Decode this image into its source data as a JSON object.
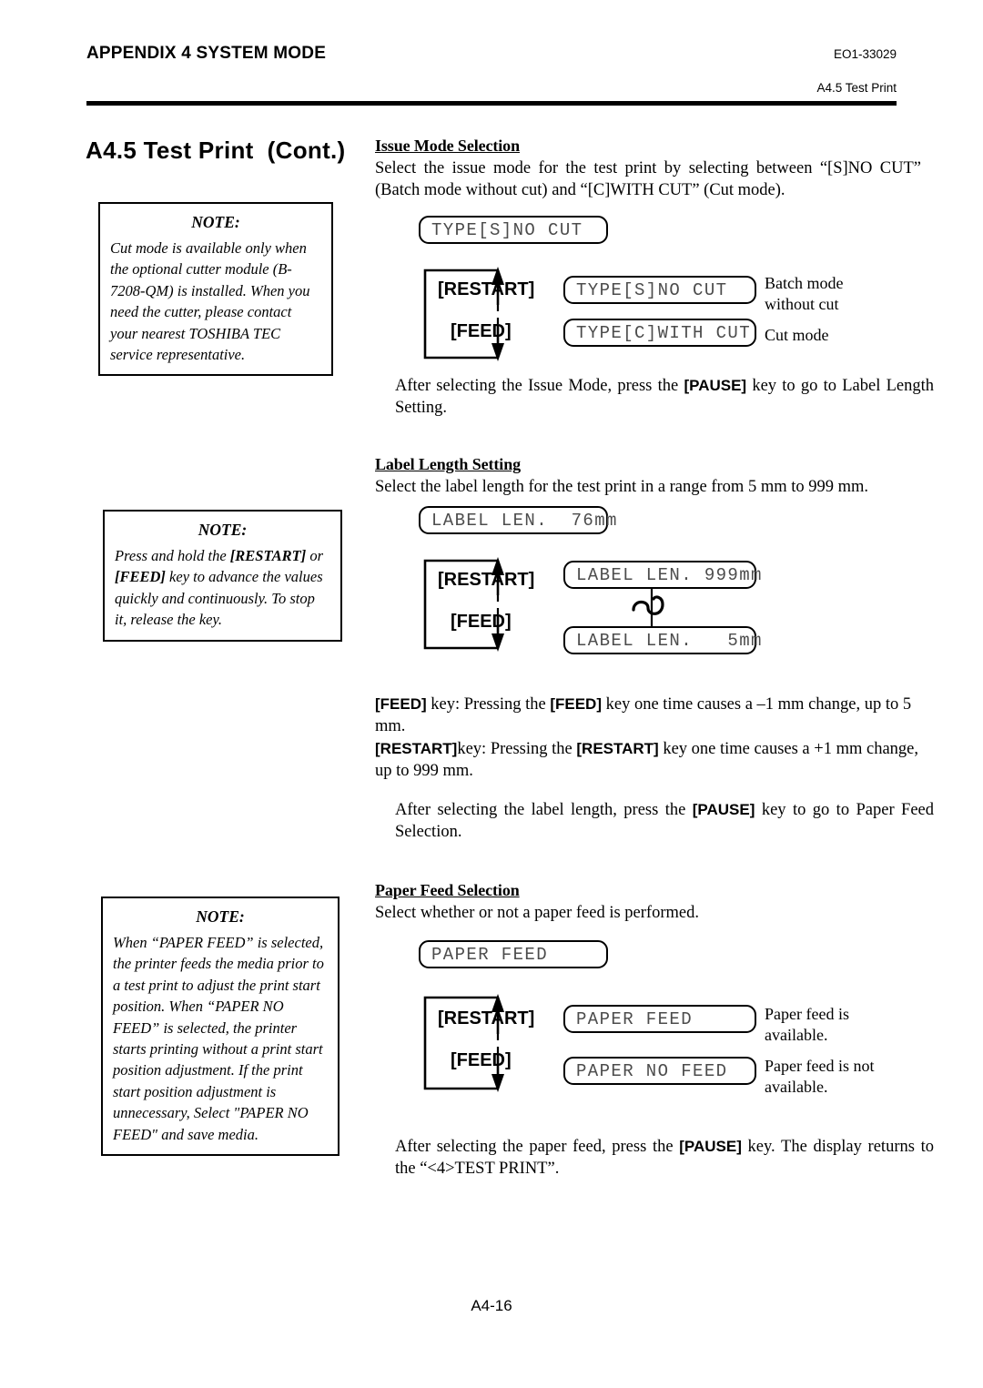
{
  "header": {
    "left_title": "APPENDIX 4 SYSTEM MODE",
    "doc_code": "EO1-33029",
    "section_ref": "A4.5 Test Print"
  },
  "page_title": "A4.5 Test Print  (Cont.)",
  "notes": [
    {
      "title": "NOTE:",
      "body": "Cut mode is available only when the optional cutter module (B-7208-QM) is installed.  When you need the cutter, please contact your nearest TOSHIBA TEC service representative."
    },
    {
      "title": "NOTE:",
      "body_pre": "Press and hold the ",
      "key1": "[RESTART]",
      "body_mid": " or ",
      "key2": "[FEED]",
      "body_post": " key to advance the values quickly and continuously. To stop it, release the key."
    },
    {
      "title": "NOTE:",
      "body": "When “PAPER FEED” is selected, the printer feeds the media prior to a test print to adjust the print start position.  When “PAPER NO FEED” is selected, the printer starts printing without a print start position adjustment.  If the print start position adjustment is unnecessary, Select \"PAPER NO FEED\" and save media."
    }
  ],
  "sections": {
    "issue_mode": {
      "heading": "Issue Mode Selection",
      "intro": "Select the issue mode for the test print by selecting between “[S]NO CUT” (Batch mode without cut) and “[C]WITH CUT” (Cut mode).",
      "current_lcd": "TYPE[S]NO CUT",
      "loop": {
        "up_key": "[RESTART]",
        "down_key": "[FEED]"
      },
      "options": [
        {
          "lcd": "TYPE[S]NO CUT",
          "desc": "Batch mode\nwithout cut"
        },
        {
          "lcd": "TYPE[C]WITH CUT",
          "desc": "Cut mode"
        }
      ],
      "after_pre": "After selecting the Issue Mode, press the ",
      "after_key": "[PAUSE]",
      "after_post": " key to go to Label Length Setting."
    },
    "label_length": {
      "heading": "Label Length Setting",
      "intro": "Select the label length for the test print in a range from 5 mm to 999 mm.",
      "current_lcd": "LABEL LEN.  76mm",
      "loop": {
        "up_key": "[RESTART]",
        "down_key": "[FEED]"
      },
      "options": [
        {
          "lcd": "LABEL LEN. 999mm"
        },
        {
          "lcd": "LABEL LEN.   5mm"
        }
      ],
      "feed_rule_pre": "",
      "feed_key_a": "[FEED]",
      "feed_rule_a": " key: Pressing the ",
      "feed_key_b": "[FEED]",
      "feed_rule_b": " key one time causes a –1 mm change, up to 5 mm.",
      "restart_key_a": "[RESTART]",
      "restart_rule_a": "key: Pressing the ",
      "restart_key_b": "[RESTART]",
      "restart_rule_b": " key one time causes a +1 mm change, up to 999 mm.",
      "after_pre": "After selecting the label length, press the ",
      "after_key": "[PAUSE]",
      "after_post": " key to go to Paper Feed Selection."
    },
    "paper_feed": {
      "heading": "Paper Feed Selection",
      "intro": "Select whether or not a paper feed is performed.",
      "current_lcd": "PAPER FEED",
      "loop": {
        "up_key": "[RESTART]",
        "down_key": "[FEED]"
      },
      "options": [
        {
          "lcd": "PAPER FEED",
          "desc": "Paper feed is\navailable."
        },
        {
          "lcd": "PAPER NO FEED",
          "desc": "Paper feed is not\navailable."
        }
      ],
      "after_pre": "After selecting the paper feed, press the ",
      "after_key": "[PAUSE]",
      "after_post": " key.  The display returns to the “<4>TEST PRINT”."
    }
  },
  "page_number": "A4-16"
}
